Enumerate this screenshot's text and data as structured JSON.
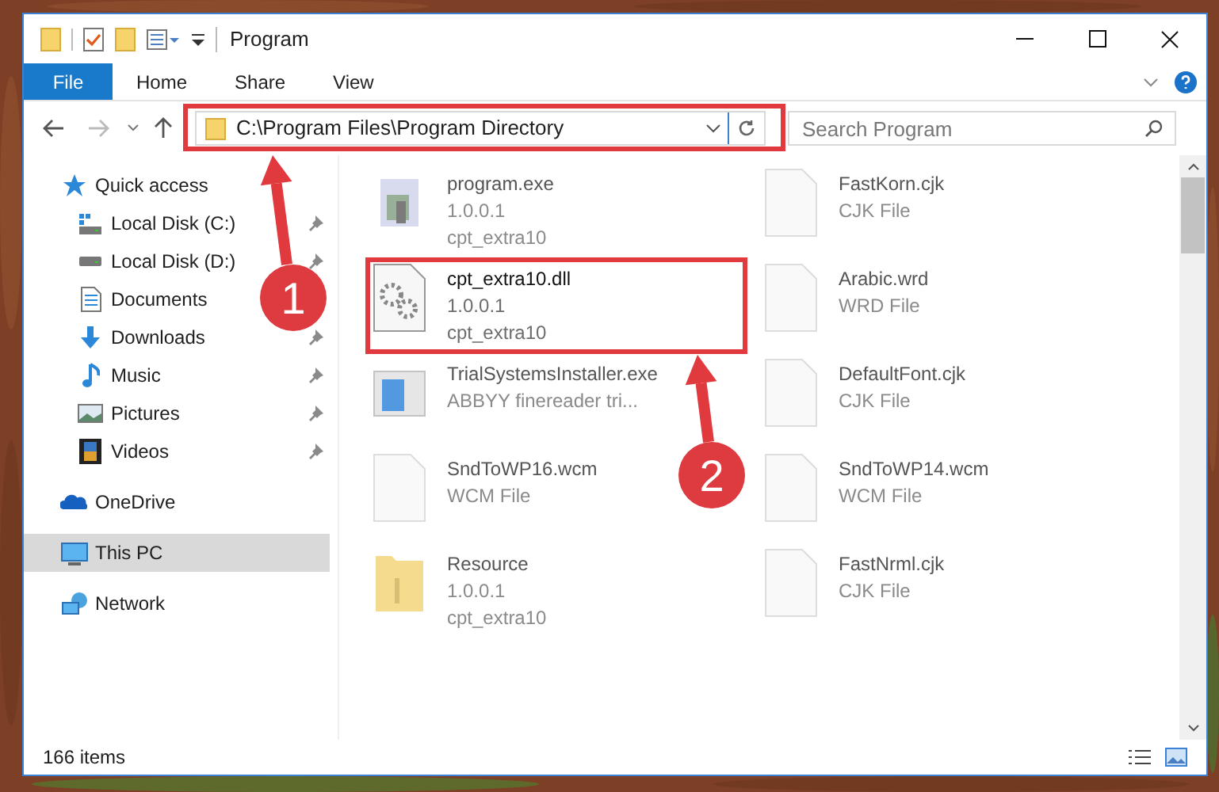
{
  "window": {
    "title": "Program"
  },
  "ribbon": {
    "tabs": [
      {
        "label": "File",
        "selected": true
      },
      {
        "label": "Home",
        "selected": false
      },
      {
        "label": "Share",
        "selected": false
      },
      {
        "label": "View",
        "selected": false
      }
    ]
  },
  "address_bar": {
    "path": "C:\\Program Files\\Program Directory"
  },
  "search": {
    "placeholder": "Search Program"
  },
  "sidebar": {
    "items": [
      {
        "label": "Quick access",
        "selected": false,
        "children": [
          {
            "label": "Local Disk (C:)",
            "pinned": true
          },
          {
            "label": "Local Disk (D:)",
            "pinned": true
          },
          {
            "label": "Documents"
          },
          {
            "label": "Downloads",
            "pinned": true
          },
          {
            "label": "Music",
            "pinned": true
          },
          {
            "label": "Pictures",
            "pinned": true
          },
          {
            "label": "Videos",
            "pinned": true
          }
        ]
      },
      {
        "label": "OneDrive",
        "selected": false
      },
      {
        "label": "This PC",
        "selected": true
      },
      {
        "label": "Network",
        "selected": false
      }
    ]
  },
  "files": [
    {
      "name": "program.exe",
      "lines": [
        "1.0.0.1",
        "cpt_extra10"
      ],
      "kind": "application",
      "blurred": true
    },
    {
      "name": "cpt_extra10.dll",
      "lines": [
        "1.0.0.1",
        "cpt_extra10"
      ],
      "kind": "library",
      "blurred": false
    },
    {
      "name": "TrialSystemsInstaller.exe",
      "lines": [
        "ABBYY finereader tri..."
      ],
      "kind": "installer",
      "blurred": true
    },
    {
      "name": "SndToWP16.wcm",
      "lines": [
        "WCM File"
      ],
      "kind": "document",
      "blurred": true
    },
    {
      "name": "Resource",
      "lines": [
        "1.0.0.1",
        "cpt_extra10"
      ],
      "kind": "folder",
      "blurred": true
    },
    {
      "name": "FastKorn.cjk",
      "lines": [
        "CJK File"
      ],
      "kind": "document",
      "blurred": true
    },
    {
      "name": "Arabic.wrd",
      "lines": [
        "WRD File"
      ],
      "kind": "document",
      "blurred": true
    },
    {
      "name": "DefaultFont.cjk",
      "lines": [
        "CJK File"
      ],
      "kind": "document",
      "blurred": true
    },
    {
      "name": "SndToWP14.wcm",
      "lines": [
        "WCM File"
      ],
      "kind": "document",
      "blurred": true
    },
    {
      "name": "FastNrml.cjk",
      "lines": [
        "CJK File"
      ],
      "kind": "document",
      "blurred": true
    }
  ],
  "status_bar": {
    "item_count": "166 items"
  },
  "annotations": [
    {
      "kind": "callout",
      "label": "1"
    },
    {
      "kind": "callout",
      "label": "2"
    }
  ]
}
